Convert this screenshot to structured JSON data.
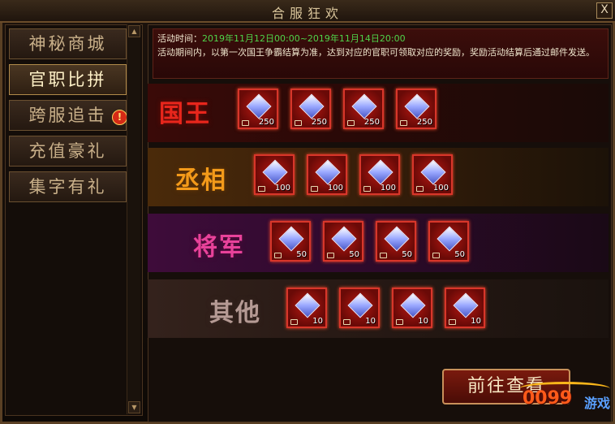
{
  "window": {
    "title": "合服狂欢",
    "close_label": "X"
  },
  "sidebar": {
    "items": [
      {
        "label": "神秘商城"
      },
      {
        "label": "官职比拼"
      },
      {
        "label": "跨服追击"
      },
      {
        "label": "充值豪礼"
      },
      {
        "label": "集字有礼"
      }
    ],
    "alert_badge": "!",
    "scroll_up": "▲",
    "scroll_down": "▼"
  },
  "info": {
    "time_label": "活动时间：",
    "time_value": "2019年11月12日00:00~2019年11月14日20:00",
    "description": "活动期间内，以第一次国王争霸结算为准，达到对应的官职可领取对应的奖励，奖励活动结算后通过邮件发送。"
  },
  "ranks": [
    {
      "name": "国王",
      "rewards": [
        {
          "qty": "250"
        },
        {
          "qty": "250"
        },
        {
          "qty": "250"
        },
        {
          "qty": "250"
        }
      ]
    },
    {
      "name": "丞相",
      "rewards": [
        {
          "qty": "100"
        },
        {
          "qty": "100"
        },
        {
          "qty": "100"
        },
        {
          "qty": "100"
        }
      ]
    },
    {
      "name": "将军",
      "rewards": [
        {
          "qty": "50"
        },
        {
          "qty": "50"
        },
        {
          "qty": "50"
        },
        {
          "qty": "50"
        }
      ]
    },
    {
      "name": "其他",
      "rewards": [
        {
          "qty": "10"
        },
        {
          "qty": "10"
        },
        {
          "qty": "10"
        },
        {
          "qty": "10"
        }
      ]
    }
  ],
  "button": {
    "label": "前往查看"
  },
  "watermark": {
    "digits": "0099",
    "brand": "游戏"
  },
  "colors": {
    "king": "#e8261c",
    "chancellor": "#f39a1a",
    "general": "#e8429a",
    "other": "#b59a94",
    "time_green": "#4fd34a"
  },
  "icons": {
    "reward": "diamond-icon",
    "bound": "lock-icon"
  }
}
